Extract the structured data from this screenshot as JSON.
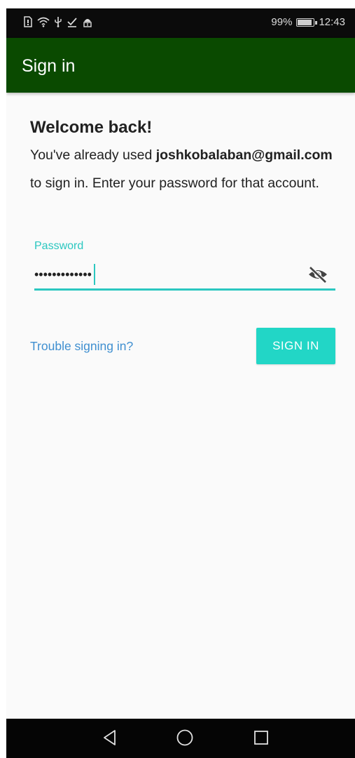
{
  "status_bar": {
    "battery_percent": "99%",
    "time": "12:43",
    "icons": [
      "sim-icon",
      "wifi-icon",
      "usb-icon",
      "download-done-icon",
      "android-debug-icon"
    ],
    "battery_level": 0.99
  },
  "app_bar": {
    "title": "Sign in",
    "color": "#0a4a00"
  },
  "welcome": {
    "title": "Welcome back!",
    "message_prefix": "You've already used ",
    "email": "joshkobalaban@gmail.com",
    "message_suffix": " to sign in. Enter your password for that account."
  },
  "password_field": {
    "label": "Password",
    "value": "•••••••••••••",
    "toggle_icon": "visibility-off-icon",
    "accent_color": "#2bc7c0"
  },
  "actions": {
    "trouble_link": "Trouble signing in?",
    "sign_in_button": "SIGN IN",
    "button_color": "#22d6c6",
    "link_color": "#3f8fd0"
  },
  "nav_bar": {
    "buttons": [
      "back-icon",
      "home-icon",
      "recents-icon"
    ]
  }
}
